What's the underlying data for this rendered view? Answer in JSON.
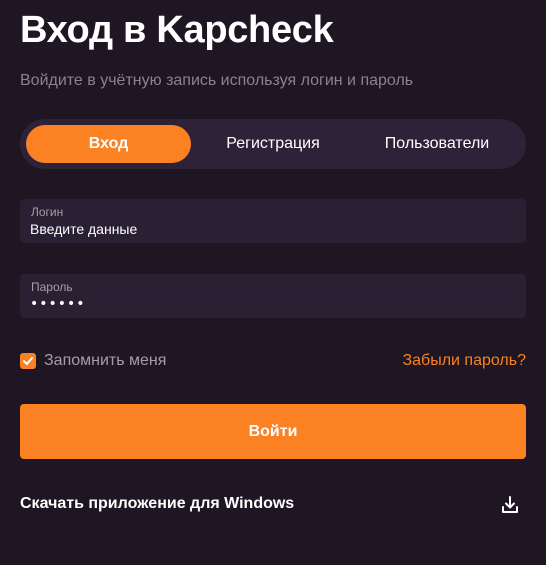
{
  "header": {
    "title": "Вход в Kapcheck",
    "subtitle": "Войдите в учётную запись используя логин и пароль"
  },
  "tabs": [
    {
      "label": "Вход",
      "active": true
    },
    {
      "label": "Регистрация",
      "active": false
    },
    {
      "label": "Пользователи",
      "active": false
    }
  ],
  "form": {
    "login_label": "Логин",
    "login_placeholder": "Введите данные",
    "password_label": "Пароль",
    "password_value": "••••••",
    "remember_label": "Запомнить меня",
    "remember_checked": true,
    "forgot_label": "Забыли пароль?",
    "submit_label": "Войти"
  },
  "footer": {
    "download_label": "Скачать приложение для Windows",
    "download_icon": "download-icon"
  },
  "colors": {
    "background": "#1e1622",
    "accent": "#fb8122",
    "panel": "#2e2238",
    "field": "#2a2033",
    "muted_text": "#8b8194"
  }
}
